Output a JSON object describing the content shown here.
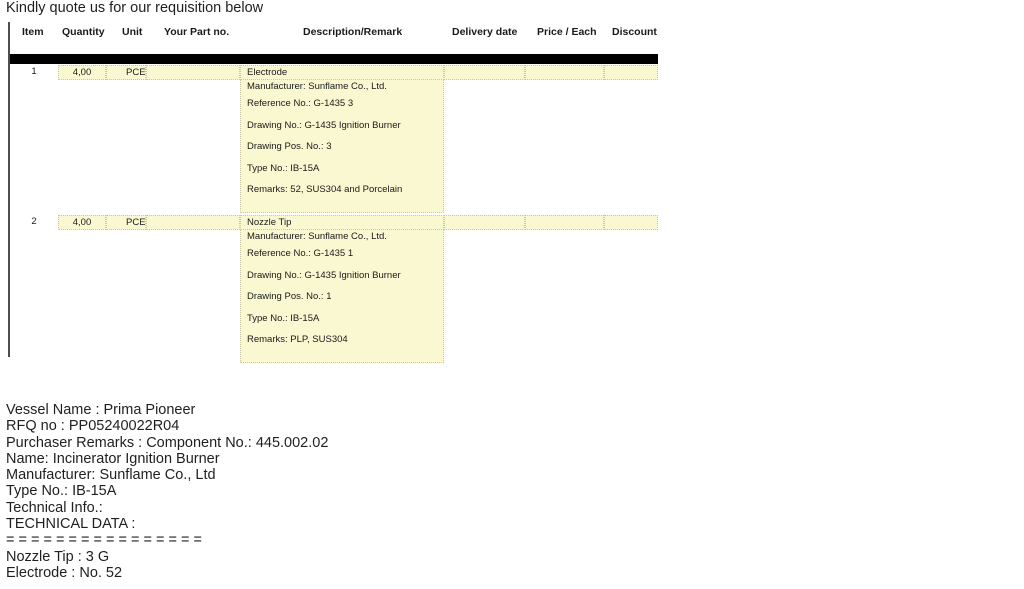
{
  "intro": "Kindly quote us for our requisition below",
  "table": {
    "columns": [
      {
        "key": "item",
        "label": "Item"
      },
      {
        "key": "quantity",
        "label": "Quantity"
      },
      {
        "key": "unit",
        "label": "Unit"
      },
      {
        "key": "part_no",
        "label": "Your Part no."
      },
      {
        "key": "desc",
        "label": "Description/Remark"
      },
      {
        "key": "delivery",
        "label": "Delivery date"
      },
      {
        "key": "price",
        "label": "Price / Each"
      },
      {
        "key": "discount",
        "label": "Discount"
      }
    ],
    "rows": [
      {
        "item": "1",
        "quantity": "4,00",
        "unit": "PCE",
        "part_no": "",
        "desc_title": "Electrode",
        "delivery": "",
        "price": "",
        "discount": "",
        "desc_lines": [
          "Manufacturer: Sunflame Co., Ltd.",
          "Reference No.: G-1435 3",
          "Drawing No.: G-1435 Ignition Burner",
          "Drawing Pos. No.: 3",
          "Type No.: IB-15A",
          "Remarks: 52, SUS304 and Porcelain"
        ]
      },
      {
        "item": "2",
        "quantity": "4,00",
        "unit": "PCE",
        "part_no": "",
        "desc_title": "Nozzle Tip",
        "delivery": "",
        "price": "",
        "discount": "",
        "desc_lines": [
          "Manufacturer: Sunflame Co., Ltd.",
          "Reference No.: G-1435 1",
          "Drawing No.: G-1435 Ignition Burner",
          "Drawing Pos. No.: 1",
          "Type No.: IB-15A",
          "Remarks: PLP, SUS304"
        ]
      }
    ]
  },
  "notes": [
    "Vessel Name : Prima Pioneer",
    "RFQ no : PP05240022R04",
    "Purchaser Remarks : Component No.: 445.002.02",
    "Name: Incinerator Ignition Burner",
    "Manufacturer: Sunflame Co., Ltd",
    "Type No.: IB-15A",
    "Technical Info.:",
    "TECHNICAL DATA :",
    "= = = = = = = = = = = = = = = =",
    "Nozzle Tip : 3 G",
    "Electrode : No. 52"
  ],
  "colors": {
    "highlight": "#faf8d0",
    "rule": "#4a4f52",
    "bar": "#000000",
    "text": "#1f1f1f"
  }
}
